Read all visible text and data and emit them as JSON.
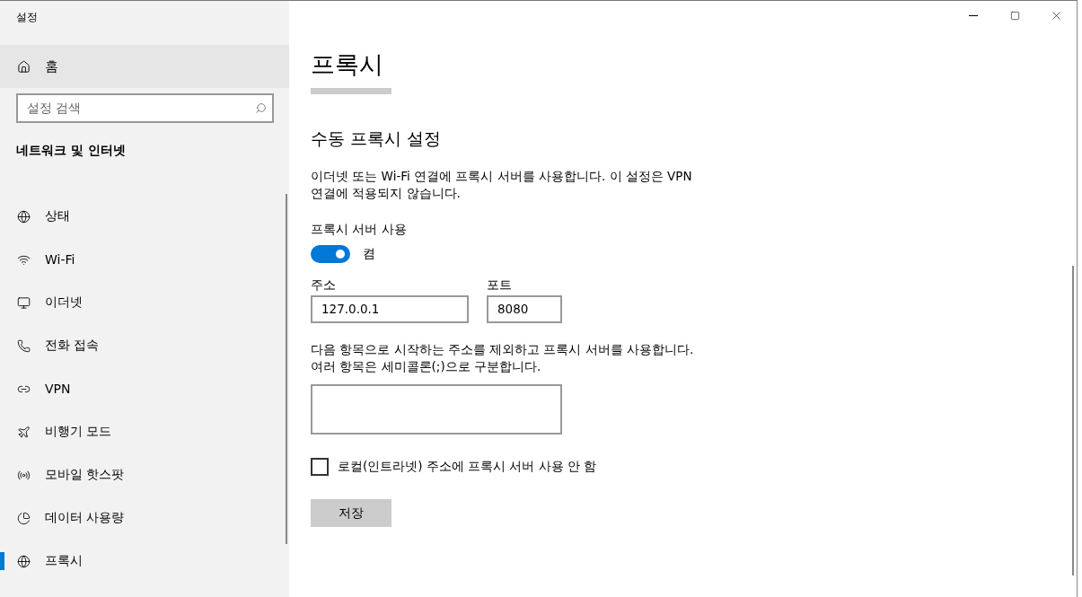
{
  "window": {
    "title": "설정"
  },
  "sidebar": {
    "home": {
      "label": "홈",
      "selected": false
    },
    "search": {
      "placeholder": "설정 검색"
    },
    "section_title": "네트워크 및 인터넷",
    "items": [
      {
        "label": "상태",
        "selected": false
      },
      {
        "label": "Wi-Fi",
        "selected": false
      },
      {
        "label": "이더넷",
        "selected": false
      },
      {
        "label": "전화 접속",
        "selected": false
      },
      {
        "label": "VPN",
        "selected": false
      },
      {
        "label": "비행기 모드",
        "selected": false
      },
      {
        "label": "모바일 핫스팟",
        "selected": false
      },
      {
        "label": "데이터 사용량",
        "selected": false
      },
      {
        "label": "프록시",
        "selected": true
      }
    ]
  },
  "main": {
    "title": "프록시",
    "section_title": "수동 프록시 설정",
    "description": "이더넷 또는 Wi-Fi 연결에 프록시 서버를 사용합니다. 이 설정은 VPN 연결에 적용되지 않습니다.",
    "proxy_toggle": {
      "label": "프록시 서버 사용",
      "on": true,
      "state_label": "켬"
    },
    "address": {
      "label": "주소",
      "value": "127.0.0.1"
    },
    "port": {
      "label": "포트",
      "value": "8080"
    },
    "exceptions": {
      "description": "다음 항목으로 시작하는 주소를 제외하고 프록시 서버를 사용합니다.\n여러 항목은 세미콜론(;)으로 구분합니다."
    },
    "bypass_local": {
      "label": "로컬(인트라넷) 주소에 프록시 서버 사용 안 함",
      "checked": false
    },
    "save_button": "저장"
  }
}
